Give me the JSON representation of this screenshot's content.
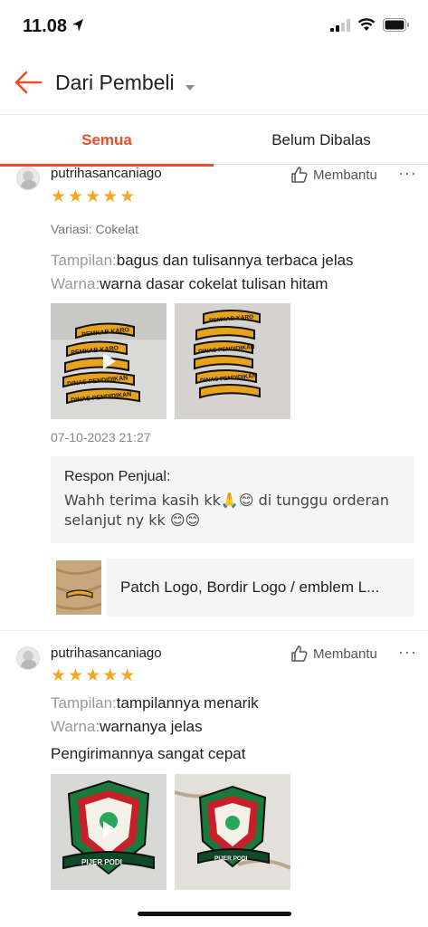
{
  "status": {
    "time": "11.08"
  },
  "nav": {
    "title": "Dari Pembeli"
  },
  "tabs": [
    {
      "label": "Semua"
    },
    {
      "label": "Belum Dibalas"
    }
  ],
  "reviews": [
    {
      "username": "putrihasancaniago",
      "helpful_label": "Membantu",
      "rating": 5,
      "stars": "★★★★★",
      "variation": "Variasi: Cokelat",
      "attributes": [
        {
          "key": "Tampilan:",
          "value": "bagus dan tulisannya terbaca jelas"
        },
        {
          "key": "Warna:",
          "value": "warna dasar cokelat tulisan hitam"
        }
      ],
      "photo_labels": [
        "PEMKAB KARO",
        "DINAS PENDIDIKAN"
      ],
      "date": "07-10-2023 21:27",
      "seller_response": {
        "title": "Respon Penjual:",
        "text": "Wahh terima kasih kk🙏😊 di tunggu orderan selanjut ny kk 😊😊"
      },
      "product": {
        "name": "Patch Logo, Bordir Logo / emblem L..."
      }
    },
    {
      "username": "putrihasancaniago",
      "helpful_label": "Membantu",
      "rating": 5,
      "stars": "★★★★★",
      "attributes": [
        {
          "key": "Tampilan:",
          "value": "tampilannya menarik"
        },
        {
          "key": "Warna:",
          "value": "warnanya jelas"
        }
      ],
      "comment": "Pengirimannya sangat cepat",
      "photo_labels": [
        "PIJER PODI"
      ]
    }
  ],
  "colors": {
    "accent": "#ee4d2d",
    "star": "#f5a623"
  }
}
